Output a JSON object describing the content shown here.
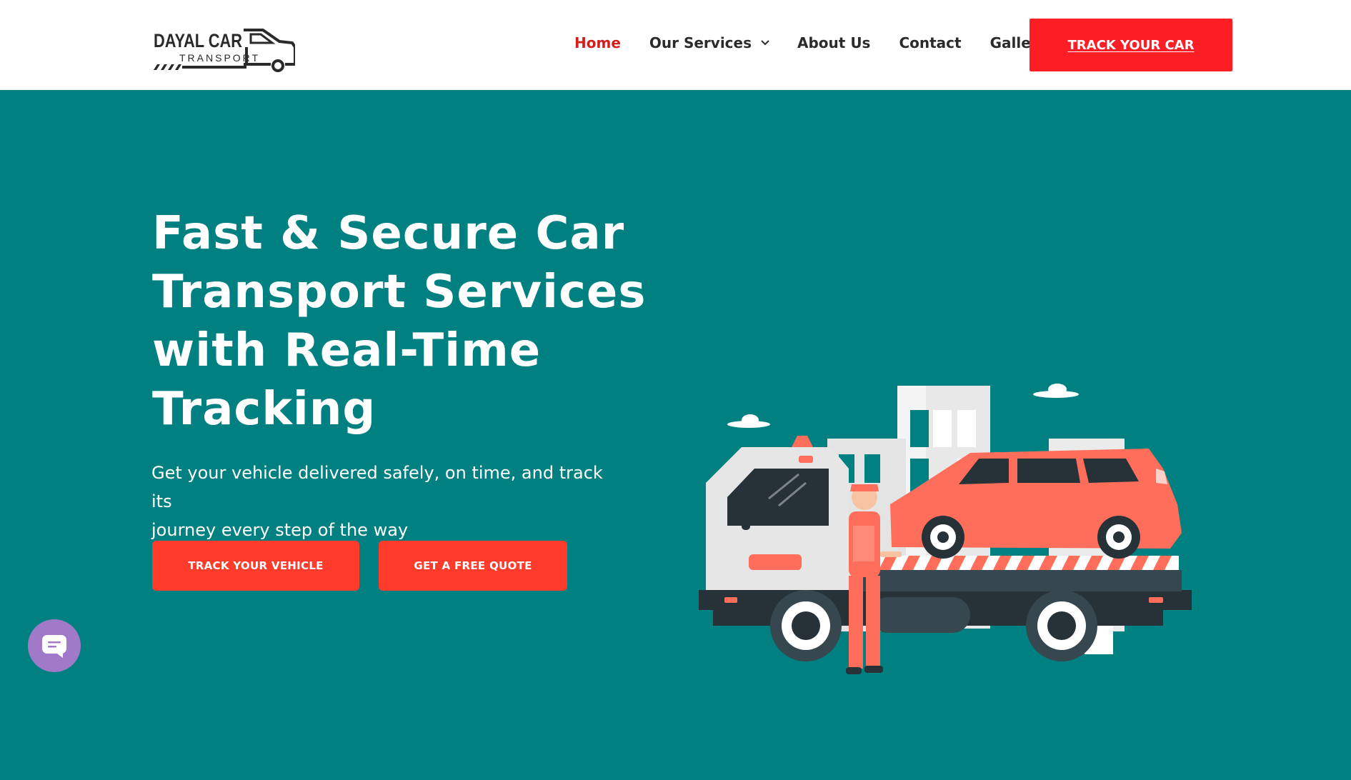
{
  "header": {
    "logo": {
      "line1": "DAYAL CAR",
      "line2": "TRANSPORT",
      "icon": "truck-logo-icon"
    },
    "nav": {
      "home": "Home",
      "services": "Our Services",
      "about": "About Us",
      "contact": "Contact",
      "gallery": "Gallery"
    },
    "track_button": "TRACK YOUR CAR"
  },
  "hero": {
    "title_lines": [
      "Fast & Secure Car",
      "Transport Services",
      "with Real-Time",
      "Tracking"
    ],
    "subtitle_lines": [
      "Get your vehicle delivered safely, on time, and track its",
      "journey every step of the way"
    ],
    "cta_primary": "TRACK YOUR VEHICLE",
    "cta_secondary": "GET A FREE QUOTE",
    "illustration": "tow-truck-carrying-car-illustration"
  },
  "chat_widget": {
    "icon": "chat-icon"
  },
  "colors": {
    "hero_bg": "#008080",
    "accent_red": "#fd1d25",
    "cta_red": "#ff3b2b",
    "nav_active": "#d41d1d",
    "chat_purple": "#a07ac9"
  }
}
